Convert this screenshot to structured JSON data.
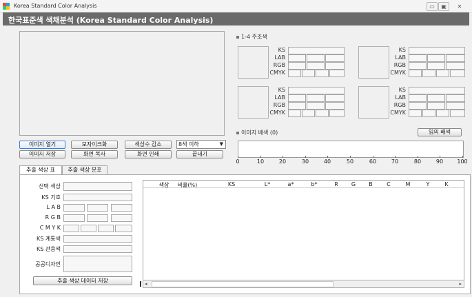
{
  "window": {
    "title": "Korea Standard Color Analysis",
    "minimize": "▭",
    "maximize": "▣",
    "close": "✕"
  },
  "header": {
    "title": "한국표준색 색채분석 (Korea Standard Color Analysis)"
  },
  "colors": {
    "header_bg": "#6a6a6a",
    "accent_border": "#3a7bd5"
  },
  "analysis": {
    "section_label": "1-4 주조색",
    "labels": {
      "ks": "KS",
      "lab": "LAB",
      "rgb": "RGB",
      "cmyk": "CMYK"
    }
  },
  "toolbar": {
    "open_image": "이미지 열기",
    "save_image": "이미지 저장",
    "mosaic": "모자이크화",
    "copy_screen": "화면 복사",
    "reduce_colors": "색상수 감소",
    "print_screen": "화면 인쇄",
    "color_count": "8색 이하",
    "exit": "끝내기"
  },
  "palette": {
    "section_label": "이미지 배색 (0)",
    "random_button": "임의 배색"
  },
  "ruler": {
    "ticks": [
      "0",
      "10",
      "20",
      "30",
      "40",
      "50",
      "60",
      "70",
      "80",
      "90",
      "100"
    ]
  },
  "tabs": [
    {
      "label": "추출 색상 표"
    },
    {
      "label": "추출 색상 분포"
    }
  ],
  "form": {
    "selected_color": "선택 색상",
    "ks_code": "KS 기호",
    "lab": "L A B",
    "rgb": "R G B",
    "cmyk": "C M Y K",
    "ks_series": "KS 계통색",
    "ks_common": "KS 관용색",
    "public_design": "공공디자인",
    "save_button": "추출 색상 데이터 저장"
  },
  "table": {
    "columns": [
      "색상",
      "비율(%)",
      "KS",
      "L*",
      "a*",
      "b*",
      "R",
      "G",
      "B",
      "C",
      "M",
      "Y",
      "K"
    ]
  }
}
